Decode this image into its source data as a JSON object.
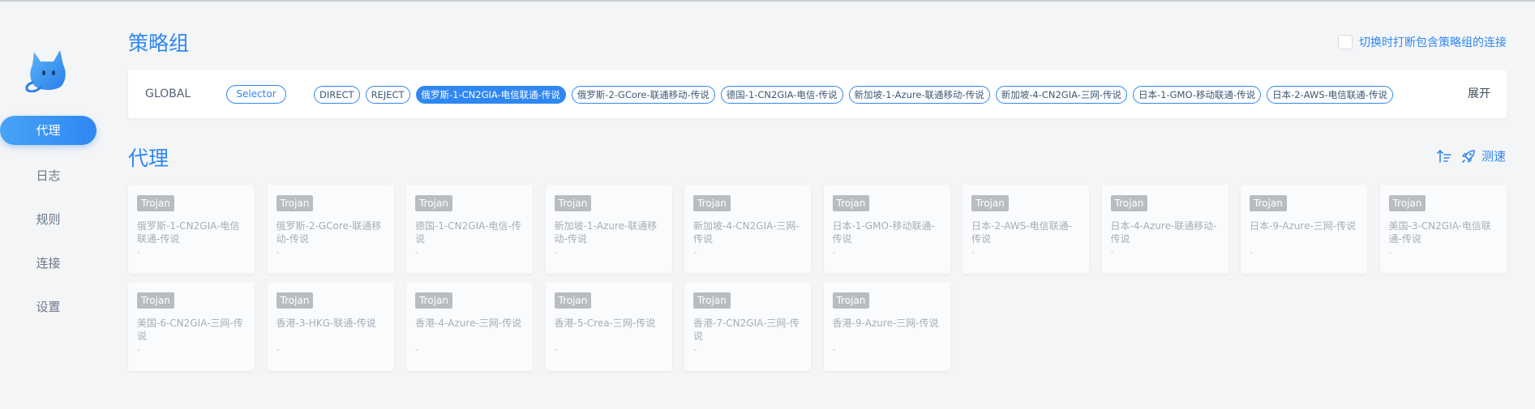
{
  "sidebar": {
    "items": [
      {
        "label": "代理",
        "active": true
      },
      {
        "label": "日志",
        "active": false
      },
      {
        "label": "规则",
        "active": false
      },
      {
        "label": "连接",
        "active": false
      },
      {
        "label": "设置",
        "active": false
      }
    ]
  },
  "group_section": {
    "title": "策略组",
    "interrupt_label": "切换时打断包含策略组的连接",
    "interrupt_checked": false,
    "group": {
      "name": "GLOBAL",
      "type": "Selector",
      "expand_label": "展开",
      "options": [
        {
          "label": "DIRECT",
          "selected": false
        },
        {
          "label": "REJECT",
          "selected": false
        },
        {
          "label": "俄罗斯-1-CN2GIA-电信联通-传说",
          "selected": true
        },
        {
          "label": "俄罗斯-2-GCore-联通移动-传说",
          "selected": false
        },
        {
          "label": "德国-1-CN2GIA-电信-传说",
          "selected": false
        },
        {
          "label": "新加坡-1-Azure-联通移动-传说",
          "selected": false
        },
        {
          "label": "新加坡-4-CN2GIA-三网-传说",
          "selected": false
        },
        {
          "label": "日本-1-GMO-移动联通-传说",
          "selected": false
        },
        {
          "label": "日本-2-AWS-电信联通-传说",
          "selected": false
        }
      ]
    }
  },
  "proxy_section": {
    "title": "代理",
    "sort_icon": "sort-icon",
    "test_icon": "rocket-icon",
    "test_label": "测速",
    "proxies": [
      {
        "type": "Trojan",
        "name": "俄罗斯-1-CN2GIA-电信联通-传说",
        "delay": "-"
      },
      {
        "type": "Trojan",
        "name": "俄罗斯-2-GCore-联通移动-传说",
        "delay": "-"
      },
      {
        "type": "Trojan",
        "name": "德国-1-CN2GIA-电信-传说",
        "delay": "-"
      },
      {
        "type": "Trojan",
        "name": "新加坡-1-Azure-联通移动-传说",
        "delay": "-"
      },
      {
        "type": "Trojan",
        "name": "新加坡-4-CN2GIA-三网-传说",
        "delay": "-"
      },
      {
        "type": "Trojan",
        "name": "日本-1-GMO-移动联通-传说",
        "delay": "-"
      },
      {
        "type": "Trojan",
        "name": "日本-2-AWS-电信联通-传说",
        "delay": "-"
      },
      {
        "type": "Trojan",
        "name": "日本-4-Azure-联通移动-传说",
        "delay": "-"
      },
      {
        "type": "Trojan",
        "name": "日本-9-Azure-三网-传说",
        "delay": "-"
      },
      {
        "type": "Trojan",
        "name": "美国-3-CN2GIA-电信联通-传说",
        "delay": "-"
      },
      {
        "type": "Trojan",
        "name": "美国-6-CN2GIA-三网-传说",
        "delay": "-"
      },
      {
        "type": "Trojan",
        "name": "香港-3-HKG-联通-传说",
        "delay": "-"
      },
      {
        "type": "Trojan",
        "name": "香港-4-Azure-三网-传说",
        "delay": "-"
      },
      {
        "type": "Trojan",
        "name": "香港-5-Crea-三网-传说",
        "delay": "-"
      },
      {
        "type": "Trojan",
        "name": "香港-7-CN2GIA-三网-传说",
        "delay": "-"
      },
      {
        "type": "Trojan",
        "name": "香港-9-Azure-三网-传说",
        "delay": "-"
      }
    ]
  },
  "colors": {
    "accent": "#2f87f2",
    "background": "#f4f5f6",
    "card": "#ffffff",
    "proxy_card": "#fafbfc",
    "type_badge": "#b9bdc2"
  }
}
